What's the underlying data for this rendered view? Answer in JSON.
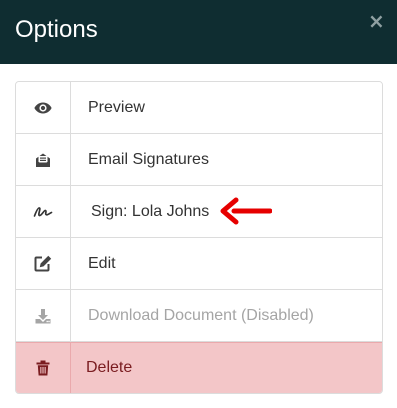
{
  "dialog": {
    "title": "Options",
    "close_glyph": "×"
  },
  "options": [
    {
      "label": "Preview",
      "icon": "eye-icon"
    },
    {
      "label": "Email Signatures",
      "icon": "envelope-open-icon"
    },
    {
      "label": "Sign: Lola Johns",
      "icon": "signature-icon"
    },
    {
      "label": "Edit",
      "icon": "pencil-square-icon"
    },
    {
      "label": "Download Document (Disabled)",
      "icon": "download-icon"
    },
    {
      "label": "Delete",
      "icon": "trash-icon"
    }
  ],
  "colors": {
    "header_bg": "#0f2d31",
    "annotation_arrow": "#e60000",
    "delete_bg": "#f3c6c8",
    "delete_text": "#7a1c20",
    "disabled_text": "#a5a5a5"
  }
}
